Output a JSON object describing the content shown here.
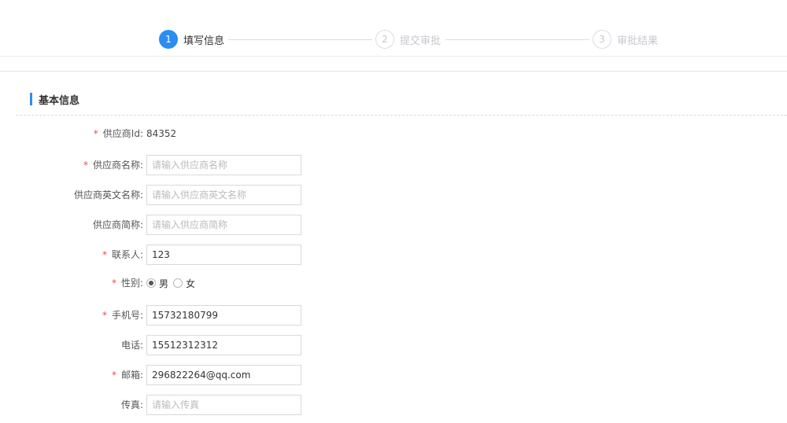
{
  "steps": [
    {
      "number": "1",
      "label": "填写信息",
      "state": "active"
    },
    {
      "number": "2",
      "label": "提交审批",
      "state": "pending"
    },
    {
      "number": "3",
      "label": "审批结果",
      "state": "pending"
    }
  ],
  "section": {
    "title": "基本信息"
  },
  "form": {
    "supplier_id": {
      "label": "供应商Id:",
      "required": "*",
      "value": "84352"
    },
    "supplier_name": {
      "label": "供应商名称:",
      "required": "*",
      "placeholder": "请输入供应商名称",
      "value": ""
    },
    "supplier_en_name": {
      "label": "供应商英文名称:",
      "placeholder": "请输入供应商英文名称",
      "value": ""
    },
    "supplier_short_name": {
      "label": "供应商简称:",
      "placeholder": "请输入供应商简称",
      "value": ""
    },
    "contact": {
      "label": "联系人:",
      "required": "*",
      "value": "123"
    },
    "gender": {
      "label": "性别:",
      "required": "*",
      "options": [
        "男",
        "女"
      ],
      "selected": "男"
    },
    "mobile": {
      "label": "手机号:",
      "required": "*",
      "value": "15732180799"
    },
    "phone": {
      "label": "电话:",
      "value": "15512312312"
    },
    "email": {
      "label": "邮箱:",
      "required": "*",
      "value": "296822264@qq.com"
    },
    "fax": {
      "label": "传真:",
      "placeholder": "请输入传真",
      "value": ""
    }
  },
  "colors": {
    "accent": "#2d8cf0",
    "required": "#e84c4c"
  }
}
